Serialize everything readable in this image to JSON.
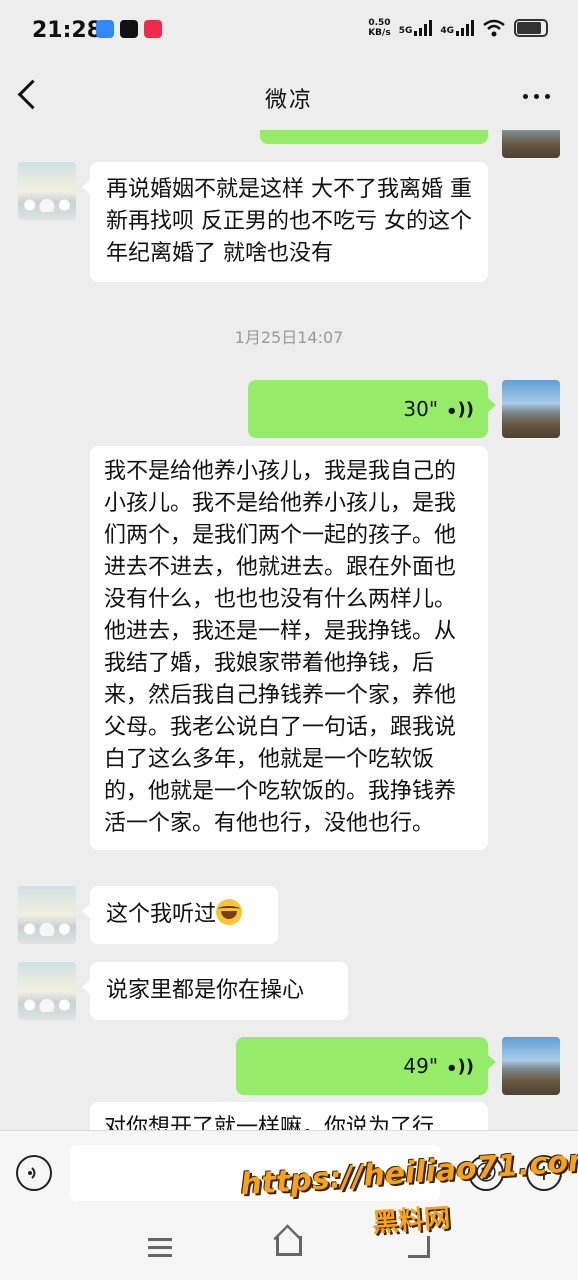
{
  "status_bar": {
    "time": "21:28",
    "net_speed": "0.50",
    "net_speed_unit": "KB/s",
    "signal1": "5G",
    "signal2": "4G"
  },
  "header": {
    "title": "微凉"
  },
  "messages": {
    "m1_text": "再说婚姻不就是这样 大不了我离婚 重新再找呗 反正男的也不吃亏 女的这个年纪离婚了 就啥也没有",
    "timestamp": "1月25日14:07",
    "m2_duration": "30\"",
    "m3_text": "我不是给他养小孩儿，我是我自己的小孩儿。我不是给他养小孩儿，是我们两个，是我们两个一起的孩子。他进去不进去，他就进去。跟在外面也没有什么，也也也没有什么两样儿。他进去，我还是一样，是我挣钱。从我结了婚，我娘家带着他挣钱，后来，然后我自己挣钱养一个家，养他父母。我老公说白了一句话，跟我说白了这么多年，他就是一个吃软饭的，他就是一个吃软饭的。我挣钱养活一个家。有他也行，没他也行。",
    "m4_text": "这个我听过",
    "m5_text": "说家里都是你在操心",
    "m6_duration": "49\"",
    "m7_text": "对你想开了就一样嘛，你说为了行"
  },
  "watermark": {
    "url": "https://heiliao71.com",
    "name": "黑料网"
  },
  "colors": {
    "background": "#ededed",
    "sent_bubble": "#95ec69",
    "received_bubble": "#ffffff",
    "watermark": "#f7a21b"
  }
}
